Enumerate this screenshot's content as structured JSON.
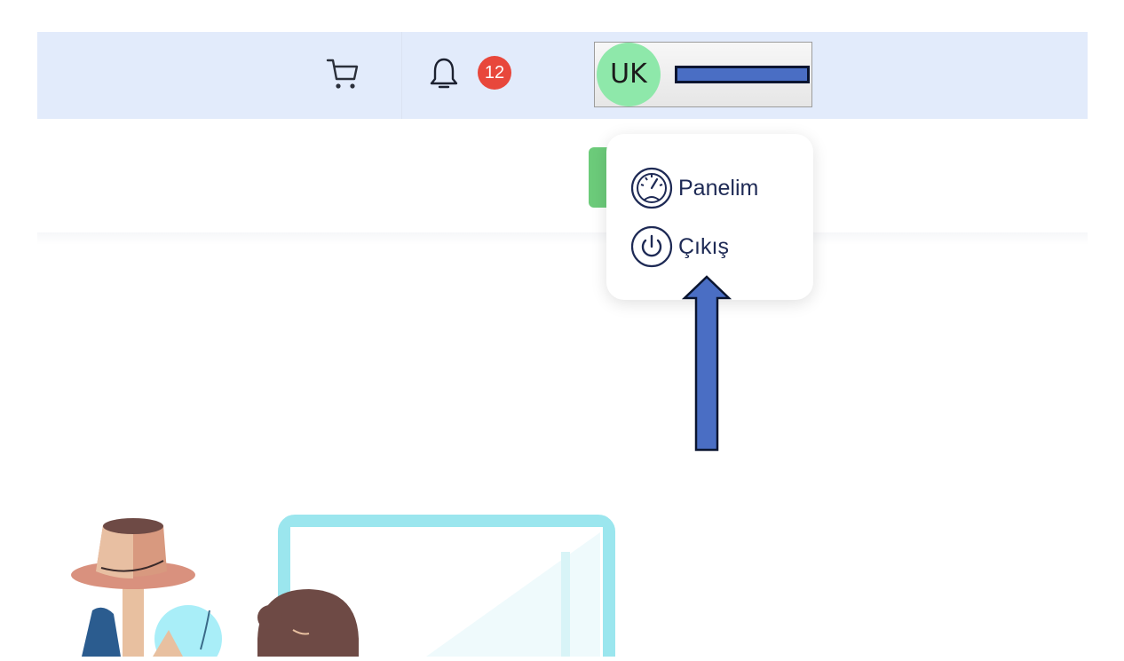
{
  "header": {
    "icons": [
      "cart-icon",
      "bell-icon"
    ],
    "notification_count": "12",
    "user": {
      "initials": "UK"
    }
  },
  "dropdown": {
    "items": [
      {
        "label": "Panelim",
        "icon": "dashboard-gauge-icon"
      },
      {
        "label": "Çıkış",
        "icon": "power-icon"
      }
    ]
  },
  "annotation": {
    "icon": "up-arrow-icon",
    "color": "#4a6ec4"
  },
  "colors": {
    "topbar_bg": "#e2ebfb",
    "badge": "#e8473b",
    "avatar": "#8ee8aa",
    "menu_text": "#1e2a55",
    "green_button": "#6ccb7a"
  }
}
